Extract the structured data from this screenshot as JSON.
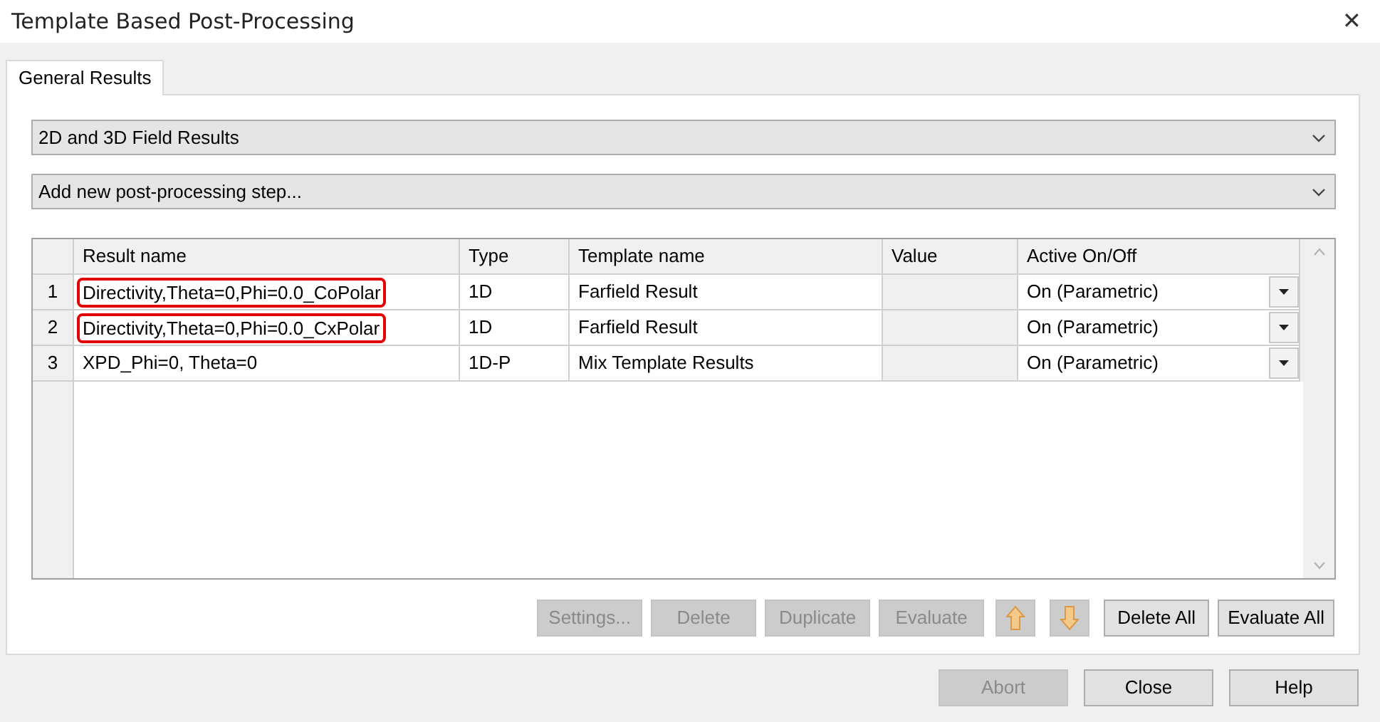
{
  "window": {
    "title": "Template Based Post-Processing",
    "close": "✕"
  },
  "tabs": [
    {
      "label": "General Results",
      "selected": true
    }
  ],
  "dropdowns": [
    {
      "value": "2D and 3D Field Results"
    },
    {
      "value": "Add new post-processing step..."
    }
  ],
  "table": {
    "columns": [
      "Result name",
      "Type",
      "Template name",
      "Value",
      "Active On/Off"
    ],
    "rows": [
      {
        "number": "1",
        "result_name": "Directivity,Theta=0,Phi=0.0_CoPolar",
        "highlighted": true,
        "type": "1D",
        "template_name": "Farfield Result",
        "active": "On (Parametric)"
      },
      {
        "number": "2",
        "result_name": "Directivity,Theta=0,Phi=0.0_CxPolar",
        "highlighted": true,
        "type": "1D",
        "template_name": "Farfield Result",
        "active": "On (Parametric)"
      },
      {
        "number": "3",
        "result_name": "XPD_Phi=0, Theta=0",
        "highlighted": false,
        "type": "1D-P",
        "template_name": "Mix Template Results",
        "active": "On (Parametric)"
      }
    ]
  },
  "actions": [
    {
      "kind": "text",
      "label": "Settings...",
      "disabled": true
    },
    {
      "kind": "text",
      "label": "Delete",
      "disabled": true
    },
    {
      "kind": "text",
      "label": "Duplicate",
      "disabled": true
    },
    {
      "kind": "text",
      "label": "Evaluate",
      "disabled": true
    },
    {
      "kind": "up",
      "disabled": true
    },
    {
      "kind": "down",
      "disabled": true
    },
    {
      "kind": "text",
      "label": "Delete All",
      "disabled": false
    },
    {
      "kind": "text",
      "label": "Evaluate All",
      "disabled": false
    }
  ],
  "footer_buttons": [
    {
      "label": "Abort",
      "disabled": true
    },
    {
      "label": "Close",
      "disabled": false
    },
    {
      "label": "Help",
      "disabled": false
    }
  ]
}
